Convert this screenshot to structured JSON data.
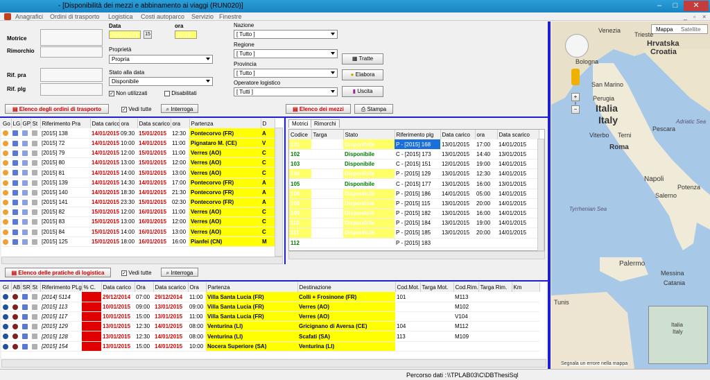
{
  "window": {
    "title_prefix": "",
    "title": "- [Disponibilità dei mezzi e abbinamento ai viaggi (RUN020)]"
  },
  "menu": [
    "Anagrafici",
    "Ordini di trasporto",
    "Logistica",
    "Costi autoparco",
    "Servizio",
    "Finestre"
  ],
  "form": {
    "motrice_label": "Motrice",
    "rimorchio_label": "Rimorchio",
    "rif_pra_label": "Rif. pra",
    "rif_plg_label": "Rif. plg",
    "data_label": "Data",
    "data_value": "26/01/2015",
    "ora_label": "ora",
    "ora_value": "15:19",
    "proprieta_label": "Proprietà",
    "proprieta_value": "Propria",
    "stato_label": "Stato alla data",
    "stato_value": "Disponibile",
    "non_utilizzati": "Non utilizzati",
    "disabilitati": "Disabilitati",
    "nazione_label": "Nazione",
    "nazione_value": "[ Tutto ]",
    "regione_label": "Regione",
    "regione_value": "[ Tutto ]",
    "provincia_label": "Provincia",
    "provincia_value": "[ Tutto ]",
    "operatore_label": "Operatore logistico",
    "operatore_value": "[ Tutti ]",
    "btn_tratte": "Tratte",
    "btn_elabora": "Elabora",
    "btn_uscita": "Uscita"
  },
  "orders_toolbar": {
    "title": "Elenco degli ordini di trasporto",
    "vedi": "Vedi tutte",
    "interroga": "Interroga"
  },
  "mezzi_toolbar": {
    "title": "Elenco dei mezzi",
    "stampa": "Stampa"
  },
  "orders": {
    "headers": [
      "Go",
      "LG",
      "GP",
      "St",
      "Riferimento Pra",
      "Data carico",
      "ora",
      "Data scarico",
      "ora",
      "Partenza",
      "D"
    ],
    "rows": [
      [
        "[2015] 138",
        "14/01/2015",
        "09:30",
        "15/01/2015",
        "12:30",
        "Pontecorvo (FR)",
        "A"
      ],
      [
        "[2015] 72",
        "14/01/2015",
        "10:00",
        "14/01/2015",
        "11:00",
        "Pignataro M. (CE)",
        "V"
      ],
      [
        "[2015] 79",
        "14/01/2015",
        "12:00",
        "15/01/2015",
        "11:00",
        "Verres (AO)",
        "C"
      ],
      [
        "[2015] 80",
        "14/01/2015",
        "13:00",
        "15/01/2015",
        "12:00",
        "Verres (AO)",
        "C"
      ],
      [
        "[2015] 81",
        "14/01/2015",
        "14:00",
        "15/01/2015",
        "13:00",
        "Verres (AO)",
        "C"
      ],
      [
        "[2015] 139",
        "14/01/2015",
        "14:30",
        "14/01/2015",
        "17:00",
        "Pontecorvo (FR)",
        "A"
      ],
      [
        "[2015] 140",
        "14/01/2015",
        "18:30",
        "14/01/2015",
        "21:30",
        "Pontecorvo (FR)",
        "A"
      ],
      [
        "[2015] 141",
        "14/01/2015",
        "23:30",
        "15/01/2015",
        "02:30",
        "Pontecorvo (FR)",
        "A"
      ],
      [
        "[2015] 82",
        "15/01/2015",
        "12:00",
        "16/01/2015",
        "11:00",
        "Verres (AO)",
        "C"
      ],
      [
        "[2015] 83",
        "15/01/2015",
        "13:00",
        "16/01/2015",
        "12:00",
        "Verres (AO)",
        "C"
      ],
      [
        "[2015] 84",
        "15/01/2015",
        "14:00",
        "16/01/2015",
        "13:00",
        "Verres (AO)",
        "C"
      ],
      [
        "[2015] 125",
        "15/01/2015",
        "18:00",
        "16/01/2015",
        "16:00",
        "Pianfei (CN)",
        "M"
      ]
    ]
  },
  "mezzi": {
    "tabs": [
      "Motrici",
      "Rimorchi"
    ],
    "headers": [
      "Codice",
      "Targa",
      "Stato",
      "Riferimento plg",
      "Data carico",
      "ora",
      "Data scarico"
    ],
    "rows": [
      [
        "101",
        "",
        "Disponibile",
        "P - [2015] 168",
        "13/01/2015",
        "17:00",
        "14/01/2015",
        "y"
      ],
      [
        "102",
        "",
        "Disponibile",
        "C - [2015] 173",
        "13/01/2015",
        "14:40",
        "13/01/2015",
        "g"
      ],
      [
        "103",
        "",
        "Disponibile",
        "C - [2015] 151",
        "12/01/2015",
        "19:00",
        "14/01/2015",
        "g"
      ],
      [
        "104",
        "",
        "Disponibile",
        "P - [2015] 129",
        "13/01/2015",
        "12:30",
        "14/01/2015",
        "y"
      ],
      [
        "105",
        "",
        "Disponibile",
        "C - [2015] 177",
        "13/01/2015",
        "16:00",
        "13/01/2015",
        "g"
      ],
      [
        "106",
        "",
        "Disponibile",
        "P - [2015] 186",
        "14/01/2015",
        "05:00",
        "14/01/2015",
        "y"
      ],
      [
        "108",
        "",
        "Disponibile",
        "P - [2015] 115",
        "13/01/2015",
        "20:00",
        "14/01/2015",
        "y"
      ],
      [
        "109",
        "",
        "Disponibile",
        "P - [2015] 182",
        "13/01/2015",
        "16:00",
        "14/01/2015",
        "y"
      ],
      [
        "110",
        "",
        "Disponibile",
        "P - [2015] 184",
        "13/01/2015",
        "19:00",
        "14/01/2015",
        "y"
      ],
      [
        "111",
        "",
        "Disponibile",
        "P - [2015] 185",
        "13/01/2015",
        "20:00",
        "14/01/2015",
        "y"
      ],
      [
        "112",
        "",
        "",
        "P - [2015] 183",
        "",
        "",
        "",
        ""
      ]
    ]
  },
  "pratiche_toolbar": {
    "title": "Elenco delle pratiche di logistica",
    "vedi": "Vedi tutte",
    "interroga": "Interroga"
  },
  "pratiche": {
    "headers": [
      "GI",
      "AB",
      "SR",
      "St",
      "Riferimento PLg",
      "% C.",
      "Data carico",
      "Ora",
      "Data scarico",
      "Ora",
      "Partenza",
      "Destinazione",
      "Cod.Mot.",
      "Targa Mot.",
      "Cod.Rim.",
      "Targa Rim.",
      "Km"
    ],
    "rows": [
      [
        "[2014] 5114",
        "0",
        "29/12/2014",
        "07:00",
        "29/12/2014",
        "11:00",
        "Villa Santa Lucia (FR)",
        "Colli + Frosinone (FR)",
        "101",
        "",
        "M113",
        ""
      ],
      [
        "[2015] 113",
        "0",
        "10/01/2015",
        "09:00",
        "13/01/2015",
        "09:00",
        "Villa Santa Lucia (FR)",
        "Verres (AO)",
        "",
        "",
        "M102",
        ""
      ],
      [
        "[2015] 117",
        "0",
        "10/01/2015",
        "15:00",
        "13/01/2015",
        "11:00",
        "Villa Santa Lucia (FR)",
        "Verres (AO)",
        "",
        "",
        "V104",
        ""
      ],
      [
        "[2015] 129",
        "0",
        "13/01/2015",
        "12:30",
        "14/01/2015",
        "08:00",
        "Venturina (LI)",
        "Gricignano di Aversa (CE)",
        "104",
        "",
        "M112",
        ""
      ],
      [
        "[2015] 128",
        "0",
        "13/01/2015",
        "12:30",
        "14/01/2015",
        "08:00",
        "Venturina (LI)",
        "Scafati (SA)",
        "113",
        "",
        "M109",
        ""
      ],
      [
        "[2015] 154",
        "0",
        "13/01/2015",
        "15:00",
        "14/01/2015",
        "10:00",
        "Nocera Superiore (SA)",
        "Venturina (LI)",
        "",
        "",
        "",
        ""
      ]
    ]
  },
  "map": {
    "tab_map": "Mappa",
    "tab_sat": "Satellite",
    "labels": [
      "Venezia",
      "Trieste",
      "Hrvatska",
      "Croatia",
      "Bologna",
      "San Marino",
      "Italia",
      "Italy",
      "Perugia",
      "Adriatic Sea",
      "Viterbo",
      "Terni",
      "Pescara",
      "Roma",
      "Napoli",
      "Salerno",
      "Tyrrhenian Sea",
      "Potenza",
      "Palermo",
      "Messina",
      "Catania",
      "Tunis",
      "Italia",
      "Italy"
    ],
    "footer": "Segnala un errore nella mappa"
  },
  "status": {
    "path_label": "Percorso dati :",
    "path_value": "\\\\TPLAB03\\C\\DBThesiSql"
  },
  "colors": {
    "accent": "#1f1fd0",
    "highlight": "#ffff00",
    "red": "#e00000",
    "green": "#008000"
  }
}
